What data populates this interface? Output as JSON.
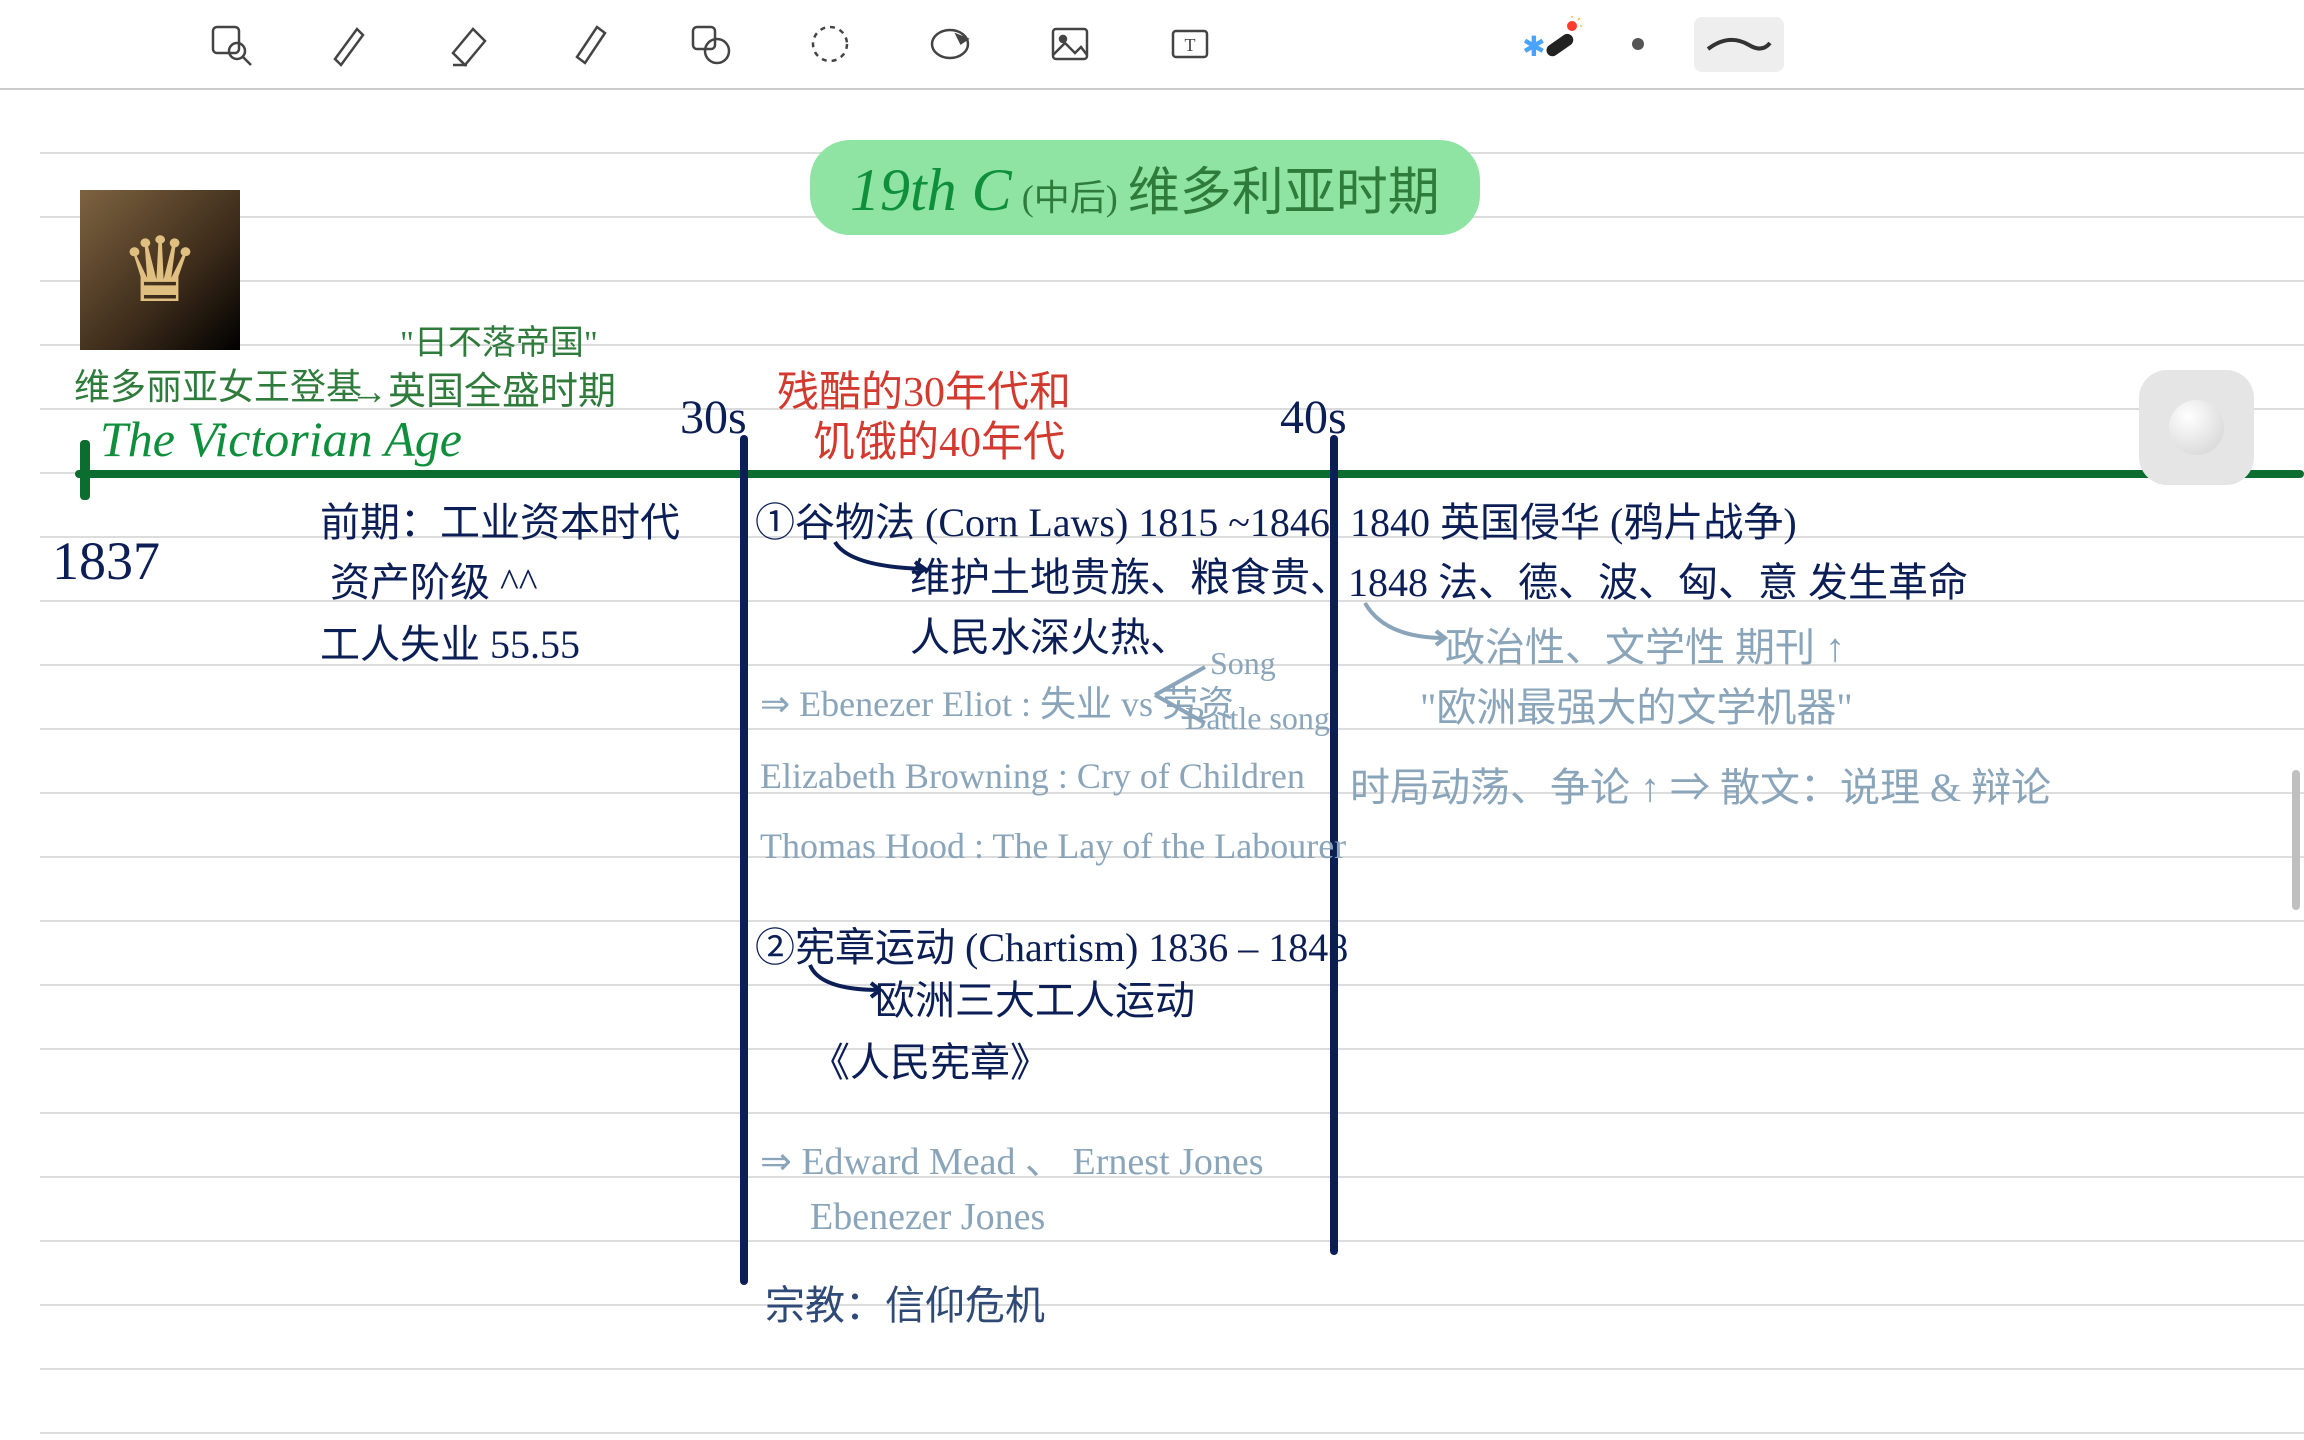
{
  "toolbar": {
    "icons": [
      "zoom-icon",
      "pen-icon",
      "highlighter-icon",
      "marker-icon",
      "eraser-shape-icon",
      "lasso-icon",
      "sticker-icon",
      "image-icon",
      "textbox-icon",
      "laser-pointer-icon",
      "dot-size-icon",
      "stroke-preview-icon"
    ],
    "bluetooth_glyph": "✱"
  },
  "title": {
    "main": "19th C",
    "sub": "(中后)",
    "cn": "维多利亚时期"
  },
  "portrait_alt": "维多利亚女王肖像",
  "header_green": {
    "queen": "维多丽亚女王登基",
    "arrow_note1": "\"日不落帝国\"",
    "arrow_note2": "英国全盛时期",
    "age": "The Victorian Age"
  },
  "timeline": {
    "year_start": "1837",
    "label_30s": "30s",
    "label_40s": "40s",
    "red_top": "残酷的30年代和",
    "red_bot": "饥饿的40年代"
  },
  "col1": {
    "l1": "前期：工业资本时代",
    "l2": "资产阶级 ^^",
    "l3": "工人失业 55.55"
  },
  "col2": {
    "corn": "①谷物法 (Corn Laws) 1815 ~1846",
    "corn_sub1": "维护土地贵族、粮食贵、",
    "corn_sub2": "人民水深火热、",
    "eliot": "⇒ Ebenezer Eliot : 失业 vs 劳资",
    "eliot_song": "Song",
    "eliot_battle": "Battle song",
    "browning": "Elizabeth Browning : Cry of Children",
    "hood": "Thomas Hood : The Lay of the Labourer",
    "chart": "②宪章运动 (Chartism) 1836 – 1848",
    "chart_sub1": "欧洲三大工人运动",
    "chart_sub2": "《人民宪章》",
    "mead": "⇒ Edward Mead 、 Ernest Jones",
    "ejones": "Ebenezer Jones",
    "relig": "宗教：信仰危机"
  },
  "col3": {
    "l1": "1840 英国侵华 (鸦片战争)",
    "l2": "1848 法、德、波、匈、意 发生革命",
    "s1": "政治性、文学性 期刊 ↑",
    "s2": "\"欧洲最强大的文学机器\"",
    "s3": "时局动荡、争论 ↑ ⇒ 散文：说理 & 辩论"
  }
}
